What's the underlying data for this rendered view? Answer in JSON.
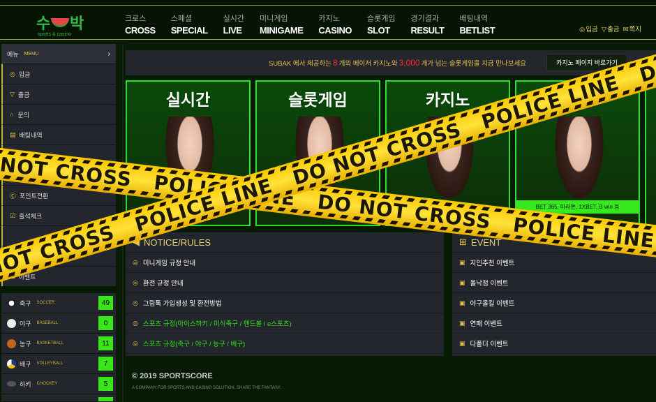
{
  "header": {
    "logo_text": "수박",
    "logo_sub": "sports & casino",
    "nav": [
      {
        "ko": "크로스",
        "en": "CROSS"
      },
      {
        "ko": "스페셜",
        "en": "SPECIAL"
      },
      {
        "ko": "실시간",
        "en": "LIVE"
      },
      {
        "ko": "미니게임",
        "en": "MINIGAME"
      },
      {
        "ko": "카지노",
        "en": "CASINO"
      },
      {
        "ko": "슬롯게임",
        "en": "SLOT"
      },
      {
        "ko": "경기결과",
        "en": "RESULT"
      },
      {
        "ko": "배팅내역",
        "en": "BETLIST"
      }
    ],
    "util": [
      "입금",
      "출금",
      "쪽지"
    ]
  },
  "sidebar": {
    "menu_ko": "메뉴",
    "menu_en": "MENU",
    "items": [
      "입금",
      "출금",
      "문의",
      "배팅내역",
      "",
      "",
      "포인트전환",
      "출석체크",
      "",
      "",
      "이벤트"
    ],
    "sports": [
      {
        "ko": "축구",
        "en": "SOCCER",
        "count": "49"
      },
      {
        "ko": "야구",
        "en": "BASEBALL",
        "count": "0"
      },
      {
        "ko": "농구",
        "en": "BASKETBALL",
        "count": "11"
      },
      {
        "ko": "배구",
        "en": "VOLLEYBALL",
        "count": "7"
      },
      {
        "ko": "하키",
        "en": "CHOCKEY",
        "count": "5"
      }
    ]
  },
  "promo": {
    "pre": "SUBAK 에서 제공하는",
    "n1": "8",
    "mid": "개의 메이저 카지노와",
    "n2": "3,000",
    "post": "개가 넘는 슬롯게임을 지금 만나보세요",
    "button": "카지노 페이지 바로가기"
  },
  "cards": [
    {
      "title": "실시간"
    },
    {
      "title": "슬롯게임"
    },
    {
      "title": "카지노"
    },
    {
      "title": "",
      "caption": "BET 365, 마라톤, 1XBET, B win 등"
    }
  ],
  "notice": {
    "title": "NOTICE/RULES",
    "items": [
      "미니게임 규정 안내",
      "환전 규정 안내",
      "그림톡 가입생성 및 환전방법",
      "스포츠 규정(아이스하키 / 미식축구 / 핸드볼 / e스포츠)",
      "스포츠 규정(축구 / 야구 / 농구 / 배구)"
    ]
  },
  "events": {
    "title": "EVENT",
    "items": [
      "지인추천 이벤트",
      "올낙첨 이벤트",
      "야구올킬 이벤트",
      "연패 이벤트",
      "다폴더 이벤트"
    ]
  },
  "footer": {
    "copyright": "© 2019 SPORTSCORE",
    "slogan": "A COMPANY FOR SPORTS AND CASINO SOLUTION. SHARE THE FANTASY."
  },
  "tape_text": "NOT CROSS   POLICE LINE   DO NOT CROSS   POLICE LINE   DO NOT CROSS   POLICE LINE   DO"
}
